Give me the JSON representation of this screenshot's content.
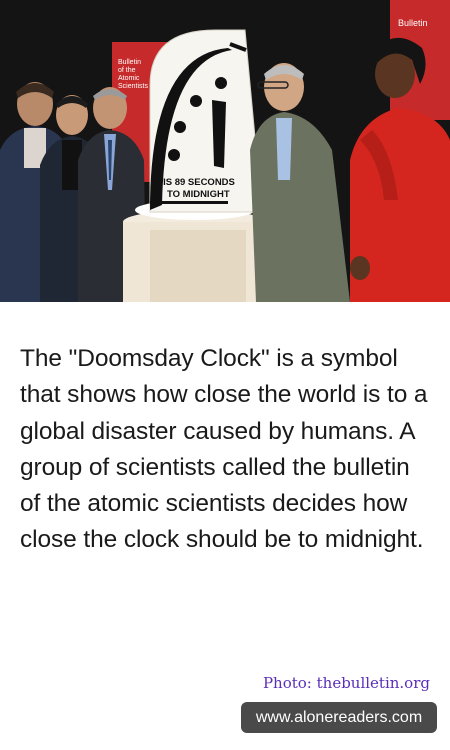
{
  "photo": {
    "clock_caption_line1": "IT IS 89 SECONDS",
    "clock_caption_line2": "TO MIDNIGHT",
    "banner_text_left": [
      "Bulletin",
      "of the",
      "Atomic",
      "Scientists"
    ],
    "banner_text_right": "Bulletin"
  },
  "article": {
    "body": "The \"Doomsday Clock\" is a symbol that shows how close the world is to a global disaster caused by humans. A group of scientists called the bulletin of the atomic scientists decides how close the clock should be to midnight."
  },
  "credit": {
    "text": "Photo: thebulletin.org"
  },
  "site": {
    "url": "www.alonereaders.com"
  }
}
